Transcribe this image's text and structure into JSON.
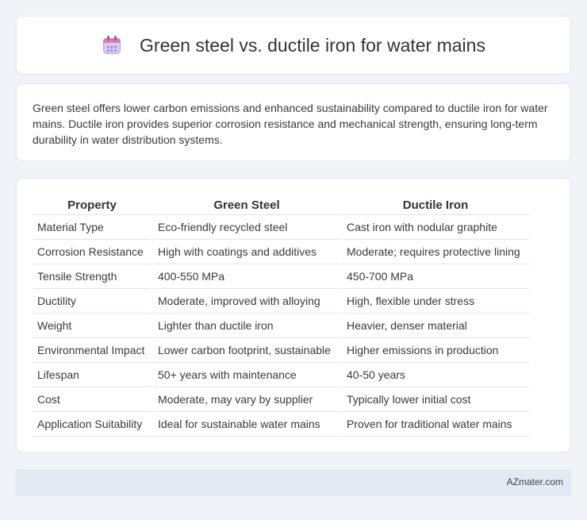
{
  "header": {
    "icon": "calendar-icon",
    "title": "Green steel vs. ductile iron for water mains"
  },
  "intro": "Green steel offers lower carbon emissions and enhanced sustainability compared to ductile iron for water mains. Ductile iron provides superior corrosion resistance and mechanical strength, ensuring long-term durability in water distribution systems.",
  "table": {
    "headers": [
      "Property",
      "Green Steel",
      "Ductile Iron"
    ],
    "rows": [
      [
        "Material Type",
        "Eco-friendly recycled steel",
        "Cast iron with nodular graphite"
      ],
      [
        "Corrosion Resistance",
        "High with coatings and additives",
        "Moderate; requires protective lining"
      ],
      [
        "Tensile Strength",
        "400-550 MPa",
        "450-700 MPa"
      ],
      [
        "Ductility",
        "Moderate, improved with alloying",
        "High, flexible under stress"
      ],
      [
        "Weight",
        "Lighter than ductile iron",
        "Heavier, denser material"
      ],
      [
        "Environmental Impact",
        "Lower carbon footprint, sustainable",
        "Higher emissions in production"
      ],
      [
        "Lifespan",
        "50+ years with maintenance",
        "40-50 years"
      ],
      [
        "Cost",
        "Moderate, may vary by supplier",
        "Typically lower initial cost"
      ],
      [
        "Application Suitability",
        "Ideal for sustainable water mains",
        "Proven for traditional water mains"
      ]
    ]
  },
  "footer": {
    "brand": "AZmater.com"
  }
}
